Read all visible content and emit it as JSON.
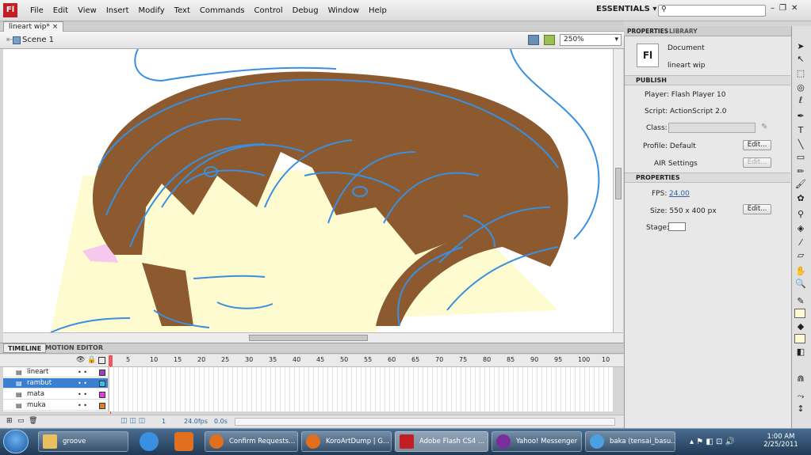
{
  "app": {
    "logo": "Fl",
    "menu": [
      "File",
      "Edit",
      "View",
      "Insert",
      "Modify",
      "Text",
      "Commands",
      "Control",
      "Debug",
      "Window",
      "Help"
    ],
    "workspace": "ESSENTIALS ▾"
  },
  "doc": {
    "tab": "lineart wip*",
    "scene": "Scene 1",
    "zoom": "250%"
  },
  "timeline": {
    "tabs": [
      "TIMELINE",
      "MOTION EDITOR"
    ],
    "frame_numbers": [
      "5",
      "10",
      "15",
      "20",
      "25",
      "30",
      "35",
      "40",
      "45",
      "50",
      "55",
      "60",
      "65",
      "70",
      "75",
      "80",
      "85",
      "90",
      "95",
      "100",
      "10"
    ],
    "layers": [
      {
        "name": "lineart",
        "color": "#a040c0",
        "selected": false
      },
      {
        "name": "rambut",
        "color": "#40c0e0",
        "selected": true
      },
      {
        "name": "mata",
        "color": "#e040e0",
        "selected": false
      },
      {
        "name": "muka",
        "color": "#e08020",
        "selected": false
      }
    ],
    "current_frame": "1",
    "fps": "24.0fps",
    "time": "0.0s"
  },
  "properties": {
    "tabs": [
      "PROPERTIES",
      "LIBRARY"
    ],
    "doc_type": "Document",
    "doc_name": "lineart wip",
    "doc_icon": "Fl",
    "publish_head": "PUBLISH",
    "player": "Player: Flash Player 10",
    "script": "Script: ActionScript 2.0",
    "class_lbl": "Class:",
    "profile": "Profile: Default",
    "edit": "Edit...",
    "air": "AIR  Settings",
    "props_head": "PROPERTIES",
    "fps_lbl": "FPS:",
    "fps_val": "24.00",
    "size": "Size:  550 x 400 px",
    "stage_lbl": "Stage:"
  },
  "taskbar": {
    "items": [
      "groove",
      "Confirm Requests...",
      "KoroArtDump | G...",
      "Adobe Flash CS4 ...",
      "Yahoo! Messenger",
      "baka (tensai_basu..."
    ],
    "time": "1:00 AM",
    "date": "2/25/2011"
  },
  "colors": {
    "hair": "#8c5a2e",
    "line": "#3a8fe0",
    "skin": "#fffbd0"
  }
}
